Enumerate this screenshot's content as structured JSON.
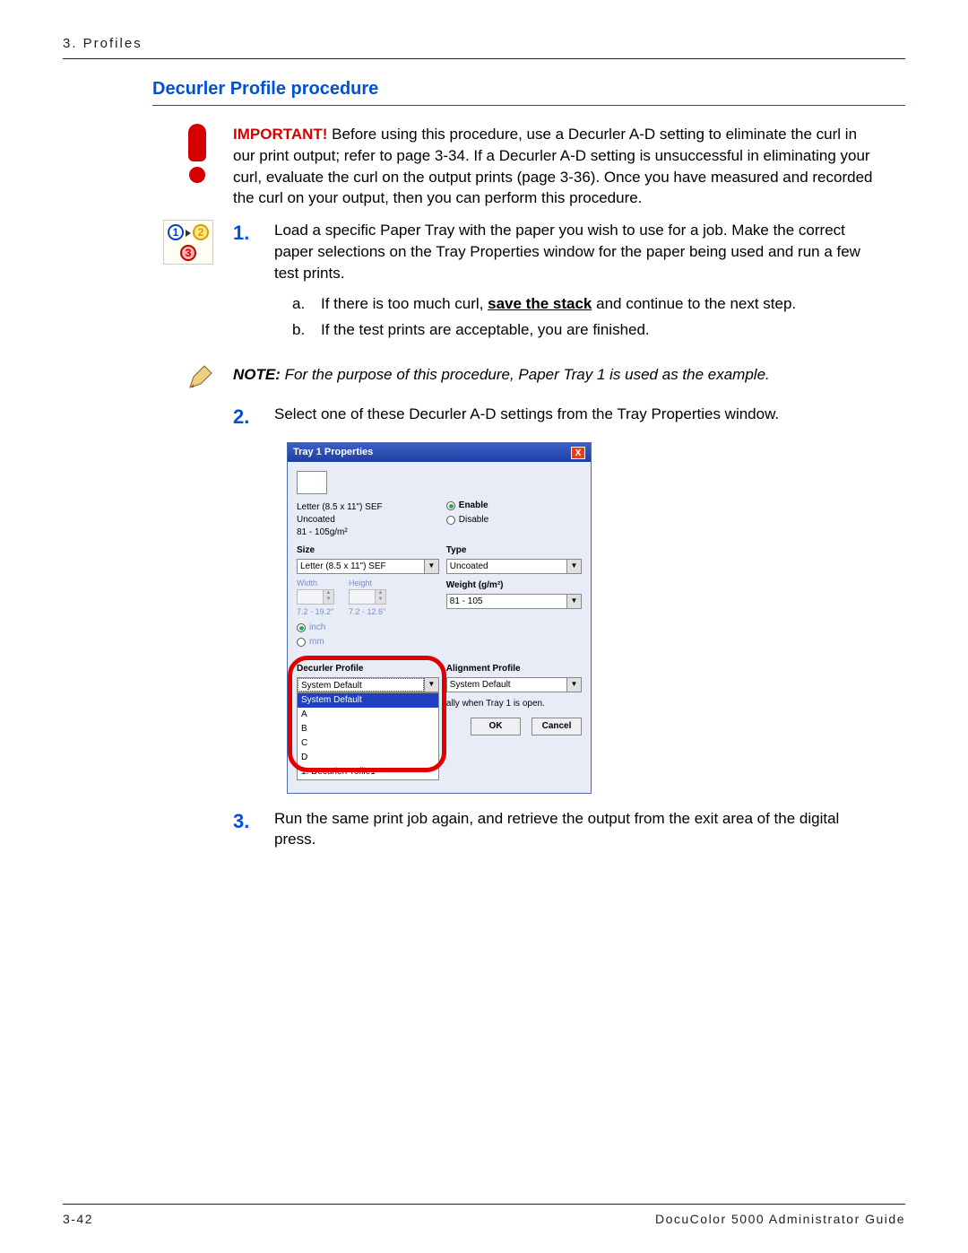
{
  "header": {
    "breadcrumb": "3. Profiles"
  },
  "section": {
    "title": "Decurler Profile procedure"
  },
  "important": {
    "label": "IMPORTANT!",
    "text": " Before using this procedure, use a Decurler A-D setting to eliminate the curl in our print output; refer to page 3-34.  If a Decurler A-D setting is unsuccessful in eliminating your curl, evaluate the curl on the output prints (page 3-36).  Once you have measured and recorded the curl on your output, then you can perform this procedure."
  },
  "steps": {
    "s1": {
      "num": "1.",
      "text": "Load a specific Paper Tray with the paper you wish to use for a job.  Make the correct paper selections on the Tray Properties window for the paper being used and run a few test prints.",
      "a_letter": "a.",
      "a_text_pre": "If there is too much curl, ",
      "a_bold": "save the stack",
      "a_text_post": " and continue to the next step.",
      "b_letter": "b.",
      "b_text": "If the test prints are acceptable, you are finished."
    },
    "note": {
      "label": "NOTE:",
      "body": " For the purpose of this procedure, Paper Tray 1 is used as the example."
    },
    "s2": {
      "num": "2.",
      "text": "Select one of these Decurler A-D settings from the Tray Properties window."
    },
    "s3": {
      "num": "3.",
      "text": "Run the same print job again, and retrieve the output from the exit area of the digital press."
    }
  },
  "dialog": {
    "title": "Tray 1 Properties",
    "close": "X",
    "paper_line1": "Letter (8.5 x 11\")  SEF",
    "paper_line2": "Uncoated",
    "paper_line3": "81 - 105g/m²",
    "enable": "Enable",
    "disable": "Disable",
    "size_label": "Size",
    "size_value": "Letter (8.5 x 11\")  SEF",
    "type_label": "Type",
    "type_value": "Uncoated",
    "width_label": "Width",
    "height_label": "Height",
    "width_range": "7.2 - 19.2\"",
    "height_range": "7.2 - 12.6\"",
    "weight_label": "Weight (g/m²)",
    "weight_value": "81 - 105",
    "unit_inch": "inch",
    "unit_mm": "mm",
    "decurler_label": "Decurler Profile",
    "decurler_value": "System Default",
    "decurler_options": [
      "System Default",
      "A",
      "B",
      "C",
      "D",
      "1. DecurlerProfile1"
    ],
    "alignment_label": "Alignment Profile",
    "alignment_value": "System Default",
    "tray_note": "ally when Tray 1 is open.",
    "ok": "OK",
    "cancel": "Cancel"
  },
  "footer": {
    "page": "3-42",
    "doc": "DocuColor 5000 Administrator Guide"
  }
}
